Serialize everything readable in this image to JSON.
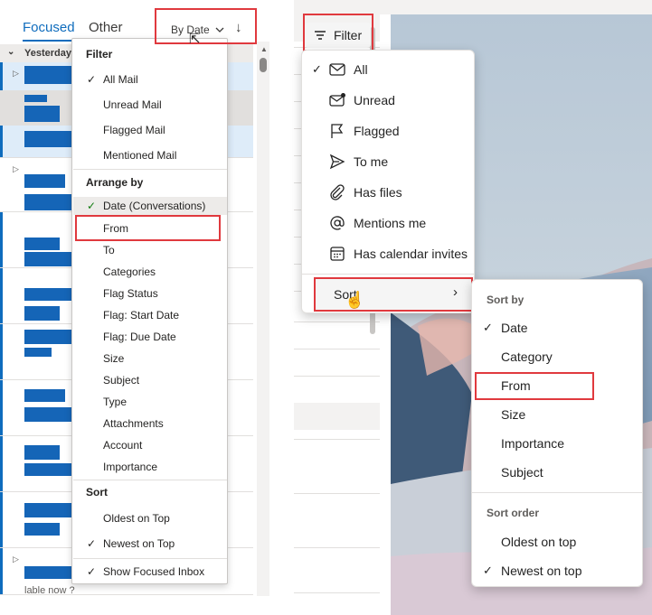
{
  "left": {
    "tabs": {
      "focused": "Focused",
      "other": "Other"
    },
    "sort_control": {
      "label": "By Date",
      "direction_icon": "arrow-down-icon"
    },
    "group_header": "Yesterday",
    "footer_text": "lable now ?",
    "menu": {
      "filter_header": "Filter",
      "filter_items": [
        "All Mail",
        "Unread Mail",
        "Flagged Mail",
        "Mentioned Mail"
      ],
      "filter_selected": "All Mail",
      "arrange_header": "Arrange by",
      "arrange_items": [
        "Date (Conversations)",
        "From",
        "To",
        "Categories",
        "Flag Status",
        "Flag: Start Date",
        "Flag: Due Date",
        "Size",
        "Subject",
        "Type",
        "Attachments",
        "Account",
        "Importance"
      ],
      "arrange_selected": "Date (Conversations)",
      "sort_header": "Sort",
      "sort_items": [
        "Oldest on Top",
        "Newest on Top"
      ],
      "sort_selected": "Newest on Top",
      "show_focused": "Show Focused Inbox"
    }
  },
  "right": {
    "filter_button": "Filter",
    "filter_menu": {
      "items": [
        {
          "label": "All",
          "icon": "mail-icon"
        },
        {
          "label": "Unread",
          "icon": "mail-unread-icon"
        },
        {
          "label": "Flagged",
          "icon": "flag-icon"
        },
        {
          "label": "To me",
          "icon": "send-icon"
        },
        {
          "label": "Has files",
          "icon": "paperclip-icon"
        },
        {
          "label": "Mentions me",
          "icon": "at-sign-icon"
        },
        {
          "label": "Has calendar invites",
          "icon": "calendar-icon"
        }
      ],
      "selected": "All",
      "sort_label": "Sort"
    },
    "sort_submenu": {
      "sort_by_header": "Sort by",
      "sort_by_items": [
        "Date",
        "Category",
        "From",
        "Size",
        "Importance",
        "Subject"
      ],
      "sort_by_selected": "Date",
      "order_header": "Sort order",
      "order_items": [
        "Oldest on top",
        "Newest on top"
      ],
      "order_selected": "Newest on top"
    }
  },
  "colors": {
    "accent": "#0f6cbd",
    "highlight_box": "#e0393e",
    "redaction": "#1565b7",
    "check_green": "#107c10"
  }
}
